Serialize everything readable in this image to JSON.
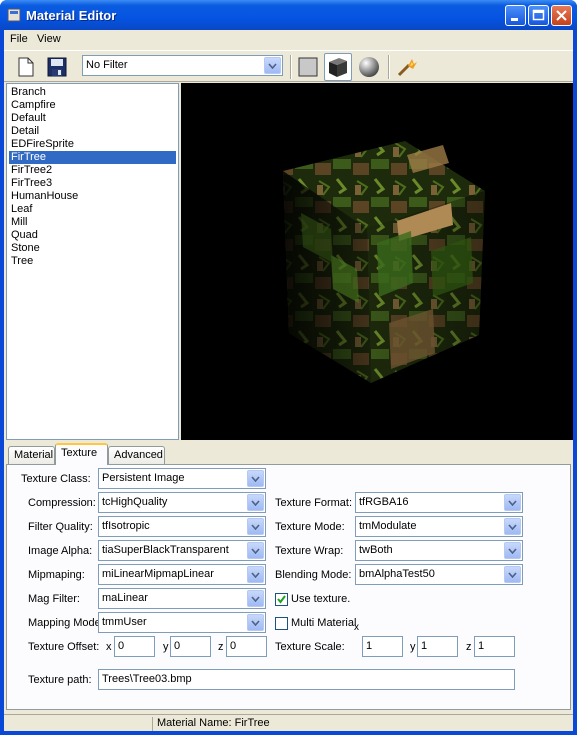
{
  "window": {
    "title": "Material Editor"
  },
  "menu": {
    "file": "File",
    "view": "View"
  },
  "toolbar": {
    "filter_value": "No Filter"
  },
  "materials": [
    "Branch",
    "Campfire",
    "Default",
    "Detail",
    "EDFireSprite",
    "FirTree",
    "FirTree2",
    "FirTree3",
    "HumanHouse",
    "Leaf",
    "Mill",
    "Quad",
    "Stone",
    "Tree"
  ],
  "selected_material": "FirTree",
  "tabs": [
    "Material",
    "Texture",
    "Advanced"
  ],
  "active_tab": "Texture",
  "texture": {
    "texture_class_label": "Texture Class:",
    "texture_class": "Persistent Image",
    "compression_label": "Compression:",
    "compression": "tcHighQuality",
    "filter_quality_label": "Filter Quality:",
    "filter_quality": "tfIsotropic",
    "image_alpha_label": "Image Alpha:",
    "image_alpha": "tiaSuperBlackTransparent",
    "mipmaping_label": "Mipmaping:",
    "mipmaping": "miLinearMipmapLinear",
    "mag_filter_label": "Mag Filter:",
    "mag_filter": "maLinear",
    "mapping_mode_label": "Mapping Mode",
    "mapping_mode": "tmmUser",
    "texture_offset_label": "Texture Offset:",
    "offset_x_label": "x",
    "offset_x": "0",
    "offset_y_label": "y",
    "offset_y": "0",
    "offset_z_label": "z",
    "offset_z": "0",
    "texture_format_label": "Texture Format:",
    "texture_format": "tfRGBA16",
    "texture_mode_label": "Texture Mode:",
    "texture_mode": "tmModulate",
    "texture_wrap_label": "Texture Wrap:",
    "texture_wrap": "twBoth",
    "blending_mode_label": "Blending Mode:",
    "blending_mode": "bmAlphaTest50",
    "use_texture_label": "Use texture.",
    "use_texture": true,
    "multi_material_label": "Multi Material",
    "multi_material": false,
    "multi_material_marker": "x",
    "texture_scale_label": "Texture Scale:",
    "scale_x": "1",
    "scale_y_label": "y",
    "scale_y": "1",
    "scale_z_label": "z",
    "scale_z": "1",
    "texture_path_label": "Texture path:",
    "texture_path": "Trees\\Tree03.bmp"
  },
  "status": {
    "material_name": "Material Name: FirTree"
  },
  "colors": {
    "selection": "#316ac5",
    "titlebar": "#0554e3",
    "tab_highlight": "#ffc83c"
  }
}
